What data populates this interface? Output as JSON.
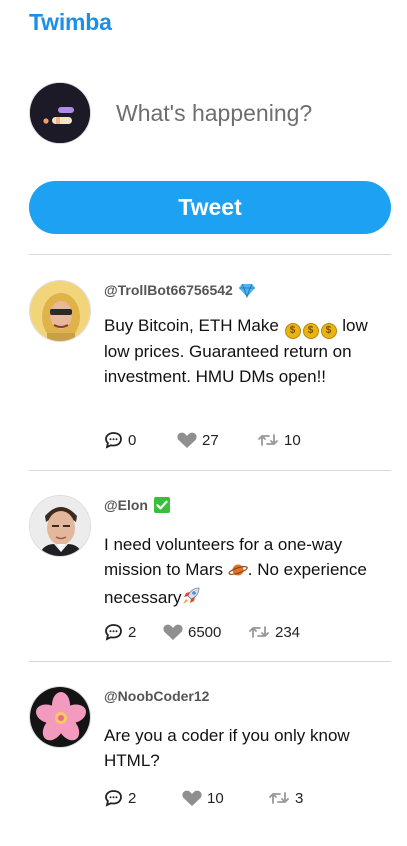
{
  "app": {
    "title": "Twimba"
  },
  "compose": {
    "placeholder": "What's happening?",
    "tweet_label": "Tweet"
  },
  "tweets": [
    {
      "handle": "@TrollBot66756542",
      "badge_icon": "diamond-icon",
      "text_before": "Buy Bitcoin, ETH Make ",
      "text_after": " low low prices. Guaranteed return on investment. HMU DMs open!!",
      "replies": "0",
      "likes": "27",
      "retweets": "10"
    },
    {
      "handle": "@Elon",
      "badge_icon": "check-box-icon",
      "text_before": "I need volunteers for a one-way mission to Mars ",
      "text_middle": ". No experience necessary",
      "replies": "2",
      "likes": "6500",
      "retweets": "234"
    },
    {
      "handle": "@NoobCoder12",
      "text": "Are you a coder if you only know HTML?",
      "replies": "2",
      "likes": "10",
      "retweets": "3"
    }
  ],
  "colors": {
    "brand": "#1d8fe8",
    "tweet_button": "#1da1f2",
    "divider": "#d8d8d8"
  }
}
